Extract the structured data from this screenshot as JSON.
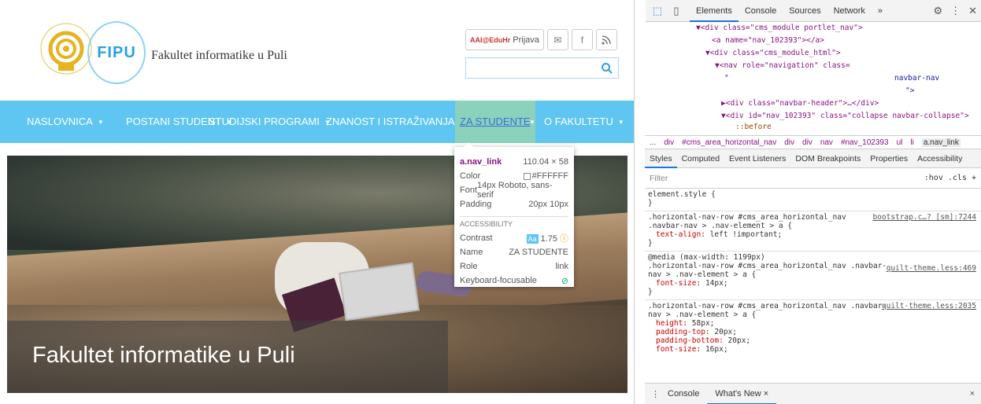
{
  "site": {
    "title": "Fakultet informatike u Puli",
    "logo_text": "FIPU",
    "seal_text": "SVEUČILIŠTE JURJA DOBRILE U PULI",
    "login": {
      "brand": "AAI@EduHr",
      "label": "Prijava"
    },
    "nav": [
      {
        "label": "NASLOVNICA"
      },
      {
        "label": "POSTANI STUDENT"
      },
      {
        "label": "STUDIJSKI PROGRAMI"
      },
      {
        "label": "ZNANOST I ISTRAŽIVANJA"
      },
      {
        "label": "ZA STUDENTE"
      },
      {
        "label": "O FAKULTETU"
      }
    ],
    "hero_title": "Fakultet informatike u Puli"
  },
  "tooltip": {
    "selector": "a.nav_link",
    "size": "110.04 × 58",
    "rows": [
      {
        "k": "Color",
        "v": "#FFFFFF"
      },
      {
        "k": "Font",
        "v": "14px Roboto, sans-serif"
      },
      {
        "k": "Padding",
        "v": "20px 10px"
      }
    ],
    "accessibility_heading": "ACCESSIBILITY",
    "contrast_label": "Contrast",
    "contrast_badge": "Aa",
    "contrast_value": "1.75",
    "name_label": "Name",
    "name_value": "ZA STUDENTE",
    "role_label": "Role",
    "role_value": "link",
    "keyboard_label": "Keyboard-focusable"
  },
  "devtools": {
    "tabs": [
      "Elements",
      "Console",
      "Sources",
      "Network",
      "»"
    ],
    "elements": [
      "▼<div class=\"cms_module portlet_nav\">",
      "<a name=\"nav_102393\"></a>",
      "▼<div class=\"cms_module_html\">",
      "▼<nav role=\"navigation\" class=",
      "\"",
      "navbar-nav",
      "\">",
      "▶<div class=\"navbar-header\">…</div>",
      "▼<div id=\"nav_102393\" class=\"collapse navbar-collapse\">",
      "::before"
    ],
    "breadcrumbs": [
      "...",
      "div",
      "#cms_area_horizontal_nav",
      "div",
      "div",
      "nav",
      "#nav_102393",
      "ul",
      "li",
      "a.nav_link"
    ],
    "subtabs": [
      "Styles",
      "Computed",
      "Event Listeners",
      "DOM Breakpoints",
      "Properties",
      "Accessibility"
    ],
    "filter_placeholder": "Filter",
    "filter_right": ":hov  .cls  +",
    "rules": [
      {
        "selector": "element.style {",
        "source": "",
        "props": [],
        "close": "}"
      },
      {
        "selector": ".horizontal-nav-row #cms_area_horizontal_nav\n.navbar-nav > .nav-element > a {",
        "source": "bootstrap.c…? [sm]:7244",
        "props": [
          {
            "p": "text-align",
            "v": "left !important;"
          }
        ],
        "close": "}"
      },
      {
        "selector": "@media (max-width: 1199px)\n.horizontal-nav-row #cms_area_horizontal_nav .navbar-\nnav > .nav-element > a {",
        "source": "quilt-theme.less:469",
        "props": [
          {
            "p": "font-size",
            "v": "14px;"
          }
        ],
        "close": "}"
      },
      {
        "selector": ".horizontal-nav-row #cms_area_horizontal_nav .navbar-\nnav > .nav-element > a {",
        "source": "quilt-theme.less:2035",
        "props": [
          {
            "p": "height",
            "v": "58px;"
          },
          {
            "p": "padding-top",
            "v": "20px;"
          },
          {
            "p": "padding-bottom",
            "v": "20px;"
          },
          {
            "p": "font-size",
            "v": "16px;"
          }
        ],
        "close": ""
      }
    ],
    "drawer_tabs": [
      "Console",
      "What's New ×"
    ],
    "drawer_close": "×"
  }
}
